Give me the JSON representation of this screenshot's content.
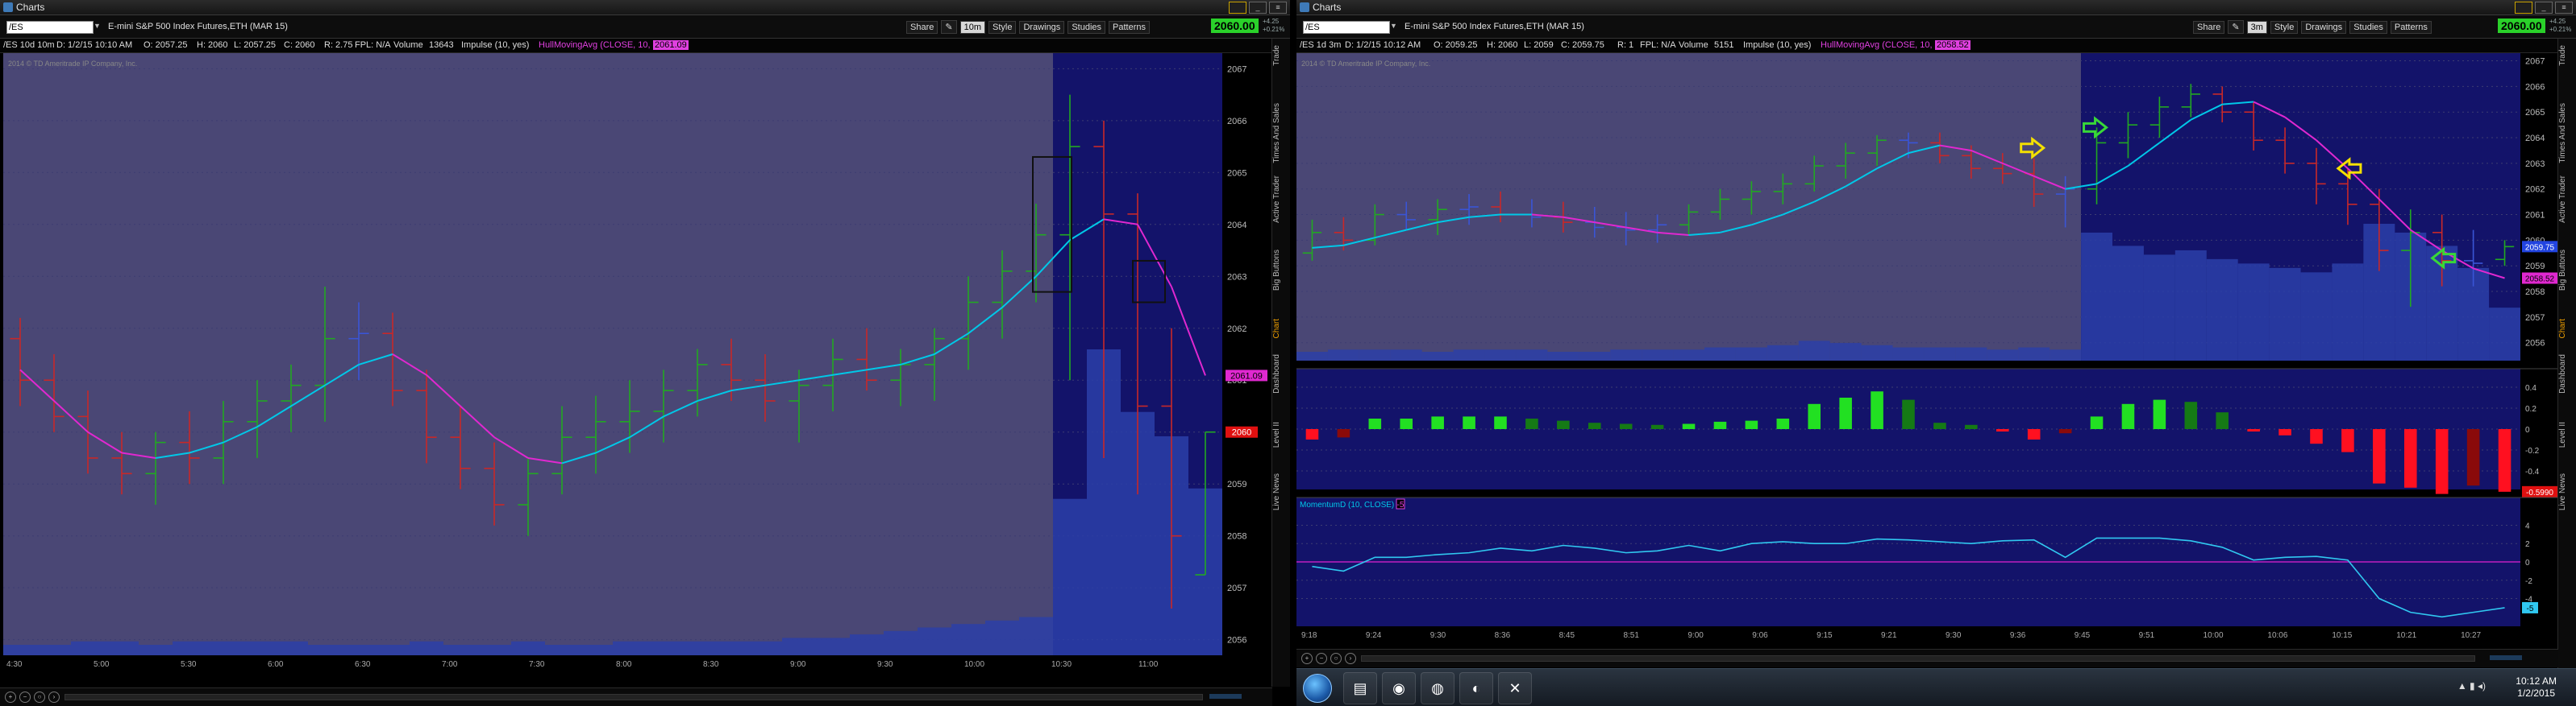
{
  "left": {
    "window_title": "Charts",
    "symbol": "/ES",
    "description": "E-mini S&P 500 Index Futures,ETH (MAR 15)",
    "toolbar": [
      "Share",
      "10m",
      "Style",
      "Drawings",
      "Studies",
      "Patterns"
    ],
    "toolbar_selected": "10m",
    "last_price": "2060.00",
    "change": [
      "+4.25",
      "+0.21%"
    ],
    "info": {
      "label": "/ES 10d 10m",
      "date": "D: 1/2/15 10:10 AM",
      "open": "O: 2057.25",
      "high": "H: 2060",
      "low": "L: 2057.25",
      "close": "C: 2060",
      "range": "R: 2.75",
      "fpl": "FPL: N/A",
      "volume_label": "Volume",
      "volume": "13643",
      "impulse": "Impulse (10, yes)",
      "hull": "HullMovingAvg (CLOSE, 10, 0)",
      "hull_value": "2061.09"
    },
    "copyright": "2014 © TD Ameritrade IP Company, Inc.",
    "price_labels": [
      "2067",
      "2066",
      "2065",
      "2064",
      "2063",
      "2062",
      "2061",
      "2060",
      "2059",
      "2058",
      "2057",
      "2056"
    ],
    "price_tags": {
      "hull": "2061.09",
      "last": "2060"
    },
    "time_labels": [
      "4:30",
      "5:00",
      "5:30",
      "6:00",
      "6:30",
      "7:00",
      "7:30",
      "8:00",
      "8:30",
      "9:00",
      "9:30",
      "10:00",
      "10:30",
      "11:00"
    ],
    "side_tabs": [
      "Trade",
      "Times And Sales",
      "Active Trader",
      "Big Buttons",
      "Chart",
      "Dashboard",
      "Level II",
      "Live News"
    ],
    "active_tab": "Chart"
  },
  "right": {
    "window_title": "Charts",
    "symbol": "/ES",
    "description": "E-mini S&P 500 Index Futures,ETH (MAR 15)",
    "toolbar": [
      "Share",
      "3m",
      "Style",
      "Drawings",
      "Studies",
      "Patterns"
    ],
    "toolbar_selected": "3m",
    "last_price": "2060.00",
    "change": [
      "+4.25",
      "+0.21%"
    ],
    "info": {
      "label": "/ES 1d 3m",
      "date": "D: 1/2/15 10:12 AM",
      "open": "O: 2059.25",
      "high": "H: 2060",
      "low": "L: 2059",
      "close": "C: 2059.75",
      "range": "R: 1",
      "fpl": "FPL: N/A",
      "volume_label": "Volume",
      "volume": "5151",
      "impulse": "Impulse (10, yes)",
      "hull": "HullMovingAvg (CLOSE, 10, 0)",
      "hull_value": "2058.52"
    },
    "copyright": "2014 © TD Ameritrade IP Company, Inc.",
    "price_labels": [
      "2067",
      "2066",
      "2065",
      "2064",
      "2063",
      "2062",
      "2061",
      "2060",
      "2059",
      "2058",
      "2057",
      "2056"
    ],
    "price_tags": {
      "current": "2059.75",
      "hull": "2058.52"
    },
    "osc_labels": [
      "0.4",
      "0.2",
      "0",
      "-0.2",
      "-0.4"
    ],
    "osc_tag": "-0.5990",
    "mom_header": "MomentumD (10, CLOSE)",
    "mom_value": "-5",
    "mom_labels": [
      "4",
      "2",
      "0",
      "-2",
      "-4"
    ],
    "mom_tag": "-5",
    "time_labels": [
      "9:18",
      "9:24",
      "9:30",
      "8:36",
      "8:45",
      "8:51",
      "9:00",
      "9:06",
      "9:15",
      "9:21",
      "9:30",
      "9:36",
      "9:45",
      "9:51",
      "10:00",
      "10:06",
      "10:15",
      "10:21",
      "10:27"
    ],
    "side_tabs": [
      "Trade",
      "Times And Sales",
      "Active Trader",
      "Big Buttons",
      "Chart",
      "Dashboard",
      "Level II",
      "Live News"
    ],
    "active_tab": "Chart"
  },
  "taskbar": {
    "time": "10:12 AM",
    "date": "1/2/2015"
  },
  "colors": {
    "premarket_bg": "#4a4775",
    "session_bg": "#13136a",
    "volume": "#2c3fa8",
    "ma_rising": "#00c8e8",
    "ma_falling": "#e028d0",
    "bar_up": "#22a822",
    "bar_down": "#c82828",
    "bar_neutral": "#3a55d6",
    "arrow_yellow": "#f4e000",
    "arrow_green": "#38d838"
  },
  "chart_data": [
    {
      "type": "bar",
      "title": "/ES 10d 10m",
      "ylim": [
        2055.7,
        2067.3
      ],
      "x": [
        "4:20",
        "4:30",
        "4:40",
        "4:50",
        "5:00",
        "5:10",
        "5:20",
        "5:30",
        "5:40",
        "5:50",
        "6:00",
        "6:10",
        "6:20",
        "6:30",
        "6:40",
        "6:50",
        "7:00",
        "7:10",
        "7:20",
        "7:30",
        "7:40",
        "7:50",
        "8:00",
        "8:10",
        "8:20",
        "8:30",
        "8:40",
        "8:50",
        "9:00",
        "9:10",
        "9:20",
        "9:30",
        "9:40",
        "9:50",
        "10:00",
        "10:10"
      ],
      "ohlc": [
        [
          2061.8,
          2062.2,
          2060.5,
          2061.0
        ],
        [
          2061.0,
          2061.5,
          2060.0,
          2060.3
        ],
        [
          2060.3,
          2060.8,
          2059.2,
          2059.5
        ],
        [
          2059.5,
          2060.0,
          2058.8,
          2059.2
        ],
        [
          2059.2,
          2060.0,
          2058.6,
          2059.8
        ],
        [
          2059.8,
          2060.4,
          2059.0,
          2059.5
        ],
        [
          2059.5,
          2060.6,
          2059.0,
          2060.2
        ],
        [
          2060.2,
          2061.0,
          2059.5,
          2060.6
        ],
        [
          2060.6,
          2061.3,
          2060.0,
          2060.9
        ],
        [
          2060.9,
          2062.8,
          2060.2,
          2061.8
        ],
        [
          2061.8,
          2062.5,
          2061.0,
          2061.9
        ],
        [
          2061.9,
          2062.3,
          2060.5,
          2060.8
        ],
        [
          2060.8,
          2061.2,
          2059.4,
          2059.9
        ],
        [
          2059.9,
          2060.5,
          2058.9,
          2059.3
        ],
        [
          2059.3,
          2059.8,
          2058.2,
          2058.6
        ],
        [
          2058.6,
          2059.5,
          2058.0,
          2059.2
        ],
        [
          2059.2,
          2060.5,
          2058.8,
          2059.9
        ],
        [
          2059.9,
          2060.7,
          2059.2,
          2060.2
        ],
        [
          2060.2,
          2061.0,
          2059.6,
          2060.4
        ],
        [
          2060.4,
          2061.2,
          2059.8,
          2060.8
        ],
        [
          2060.8,
          2061.6,
          2060.3,
          2061.3
        ],
        [
          2061.3,
          2061.8,
          2060.6,
          2061.0
        ],
        [
          2061.0,
          2061.5,
          2060.2,
          2060.6
        ],
        [
          2060.6,
          2061.2,
          2059.8,
          2060.9
        ],
        [
          2060.9,
          2061.8,
          2060.4,
          2061.4
        ],
        [
          2061.4,
          2062.0,
          2060.8,
          2061.0
        ],
        [
          2061.0,
          2061.6,
          2060.5,
          2061.3
        ],
        [
          2061.3,
          2062.0,
          2060.6,
          2061.8
        ],
        [
          2061.8,
          2063.0,
          2061.2,
          2062.5
        ],
        [
          2062.5,
          2063.5,
          2061.8,
          2063.1
        ],
        [
          2063.1,
          2064.4,
          2062.5,
          2063.8
        ],
        [
          2063.8,
          2066.5,
          2061.0,
          2065.5
        ],
        [
          2065.5,
          2066.0,
          2059.5,
          2064.2
        ],
        [
          2064.2,
          2064.6,
          2058.8,
          2060.5
        ],
        [
          2060.5,
          2062.0,
          2056.6,
          2058.0
        ],
        [
          2057.25,
          2060.0,
          2057.25,
          2060.0
        ]
      ],
      "ma": [
        2061.2,
        2060.6,
        2060.0,
        2059.6,
        2059.5,
        2059.6,
        2059.8,
        2060.1,
        2060.5,
        2060.9,
        2061.3,
        2061.5,
        2061.1,
        2060.5,
        2059.9,
        2059.5,
        2059.4,
        2059.6,
        2059.9,
        2060.3,
        2060.6,
        2060.8,
        2060.9,
        2061.0,
        2061.1,
        2061.2,
        2061.3,
        2061.5,
        2061.9,
        2062.4,
        2063.0,
        2063.7,
        2064.1,
        2064.0,
        2062.8,
        2061.09
      ],
      "volume": [
        3,
        3,
        4,
        4,
        3,
        4,
        4,
        4,
        4,
        3,
        3,
        3,
        4,
        3,
        3,
        4,
        3,
        3,
        4,
        4,
        4,
        4,
        4,
        5,
        5,
        6,
        7,
        8,
        9,
        10,
        11,
        45,
        88,
        70,
        63,
        48
      ]
    },
    {
      "type": "bar",
      "title": "/ES 1d 3m",
      "ylim": [
        2055.3,
        2067.3
      ],
      "x": [
        "9:18",
        "9:21",
        "9:24",
        "9:27",
        "9:30",
        "8:33",
        "8:36",
        "8:39",
        "8:42",
        "8:45",
        "8:48",
        "8:51",
        "8:54",
        "8:57",
        "9:00",
        "9:03",
        "9:06",
        "9:09",
        "9:12",
        "9:15",
        "9:18",
        "9:21",
        "9:24",
        "9:27",
        "9:30",
        "9:33",
        "9:36",
        "9:39",
        "9:42",
        "9:45",
        "9:48",
        "9:51",
        "9:54",
        "9:57",
        "10:00",
        "10:03",
        "10:06",
        "10:09",
        "10:12"
      ],
      "ohlc": [
        [
          2059.5,
          2060.8,
          2059.2,
          2060.3
        ],
        [
          2060.3,
          2060.9,
          2059.6,
          2060.0
        ],
        [
          2060.0,
          2061.4,
          2059.8,
          2061.0
        ],
        [
          2061.0,
          2061.5,
          2060.4,
          2060.8
        ],
        [
          2060.8,
          2061.6,
          2060.2,
          2061.2
        ],
        [
          2061.2,
          2061.8,
          2060.6,
          2061.3
        ],
        [
          2061.3,
          2061.9,
          2060.7,
          2061.0
        ],
        [
          2061.0,
          2061.6,
          2060.5,
          2060.9
        ],
        [
          2060.9,
          2061.5,
          2060.3,
          2060.7
        ],
        [
          2060.7,
          2061.3,
          2060.1,
          2060.5
        ],
        [
          2060.5,
          2061.1,
          2059.8,
          2060.4
        ],
        [
          2060.4,
          2061.0,
          2059.9,
          2060.6
        ],
        [
          2060.6,
          2061.4,
          2060.2,
          2061.1
        ],
        [
          2061.1,
          2062.0,
          2060.8,
          2061.6
        ],
        [
          2061.6,
          2062.3,
          2061.0,
          2061.9
        ],
        [
          2061.9,
          2062.6,
          2061.4,
          2062.2
        ],
        [
          2062.2,
          2063.3,
          2061.9,
          2062.9
        ],
        [
          2062.9,
          2063.8,
          2062.4,
          2063.4
        ],
        [
          2063.4,
          2064.1,
          2062.9,
          2063.9
        ],
        [
          2063.9,
          2064.2,
          2063.2,
          2063.8
        ],
        [
          2063.8,
          2064.2,
          2063.0,
          2063.3
        ],
        [
          2063.3,
          2063.7,
          2062.4,
          2062.8
        ],
        [
          2062.8,
          2063.4,
          2062.2,
          2062.6
        ],
        [
          2062.6,
          2063.2,
          2061.3,
          2061.8
        ],
        [
          2061.8,
          2062.5,
          2060.5,
          2062.0
        ],
        [
          2062.0,
          2064.4,
          2061.4,
          2063.8
        ],
        [
          2063.8,
          2065.0,
          2063.2,
          2064.5
        ],
        [
          2064.5,
          2065.6,
          2064.0,
          2065.2
        ],
        [
          2065.2,
          2066.1,
          2064.8,
          2065.7
        ],
        [
          2065.7,
          2066.0,
          2064.6,
          2065.0
        ],
        [
          2065.0,
          2065.4,
          2063.5,
          2063.9
        ],
        [
          2063.9,
          2064.4,
          2062.6,
          2063.0
        ],
        [
          2063.0,
          2063.6,
          2061.4,
          2062.2
        ],
        [
          2062.2,
          2062.8,
          2060.6,
          2061.4
        ],
        [
          2061.4,
          2062.0,
          2058.8,
          2059.6
        ],
        [
          2059.6,
          2061.2,
          2057.4,
          2060.3
        ],
        [
          2060.3,
          2061.0,
          2058.2,
          2059.2
        ],
        [
          2059.2,
          2060.4,
          2058.2,
          2059.1
        ],
        [
          2059.25,
          2060.0,
          2059.0,
          2059.75
        ]
      ],
      "ma": [
        2059.7,
        2059.8,
        2060.1,
        2060.4,
        2060.7,
        2060.9,
        2061.0,
        2061.0,
        2060.9,
        2060.7,
        2060.5,
        2060.3,
        2060.2,
        2060.3,
        2060.6,
        2061.0,
        2061.5,
        2062.1,
        2062.8,
        2063.4,
        2063.7,
        2063.5,
        2063.0,
        2062.5,
        2062.0,
        2062.2,
        2062.9,
        2063.8,
        2064.7,
        2065.3,
        2065.4,
        2064.8,
        2063.9,
        2062.8,
        2061.6,
        2060.4,
        2059.6,
        2058.9,
        2058.52
      ],
      "volume": [
        4,
        5,
        5,
        5,
        4,
        5,
        5,
        5,
        4,
        4,
        5,
        5,
        5,
        6,
        6,
        7,
        9,
        8,
        7,
        6,
        6,
        6,
        5,
        6,
        5,
        58,
        52,
        48,
        50,
        46,
        44,
        42,
        40,
        44,
        62,
        58,
        52,
        42,
        24
      ],
      "oscillator": [
        -0.1,
        -0.08,
        0.1,
        0.1,
        0.12,
        0.12,
        0.12,
        0.1,
        0.08,
        0.06,
        0.05,
        0.04,
        0.05,
        0.07,
        0.08,
        0.1,
        0.24,
        0.3,
        0.36,
        0.28,
        0.06,
        0.04,
        -0.02,
        -0.1,
        -0.04,
        0.12,
        0.24,
        0.28,
        0.26,
        0.16,
        -0.02,
        -0.06,
        -0.14,
        -0.22,
        -0.52,
        -0.56,
        -0.62,
        -0.54,
        -0.599
      ],
      "momentum": [
        -0.5,
        -1.0,
        0.5,
        0.5,
        0.8,
        1.0,
        1.5,
        1.2,
        1.8,
        1.5,
        1.0,
        1.2,
        1.8,
        1.2,
        2.0,
        2.2,
        2.0,
        2.0,
        2.5,
        2.4,
        2.2,
        2.0,
        2.3,
        2.4,
        0.5,
        2.6,
        2.6,
        2.6,
        2.3,
        1.6,
        0.2,
        0.5,
        0.6,
        0.2,
        -4.0,
        -5.5,
        -6.0,
        -5.5,
        -5.0
      ],
      "arrows": [
        {
          "color": "yellow",
          "dir": "right",
          "i": 23,
          "price": 2063.6
        },
        {
          "color": "green",
          "dir": "right",
          "i": 25,
          "price": 2064.4
        },
        {
          "color": "yellow",
          "dir": "left",
          "i": 33,
          "price": 2062.8
        },
        {
          "color": "green",
          "dir": "left",
          "i": 36,
          "price": 2059.3
        }
      ]
    }
  ]
}
